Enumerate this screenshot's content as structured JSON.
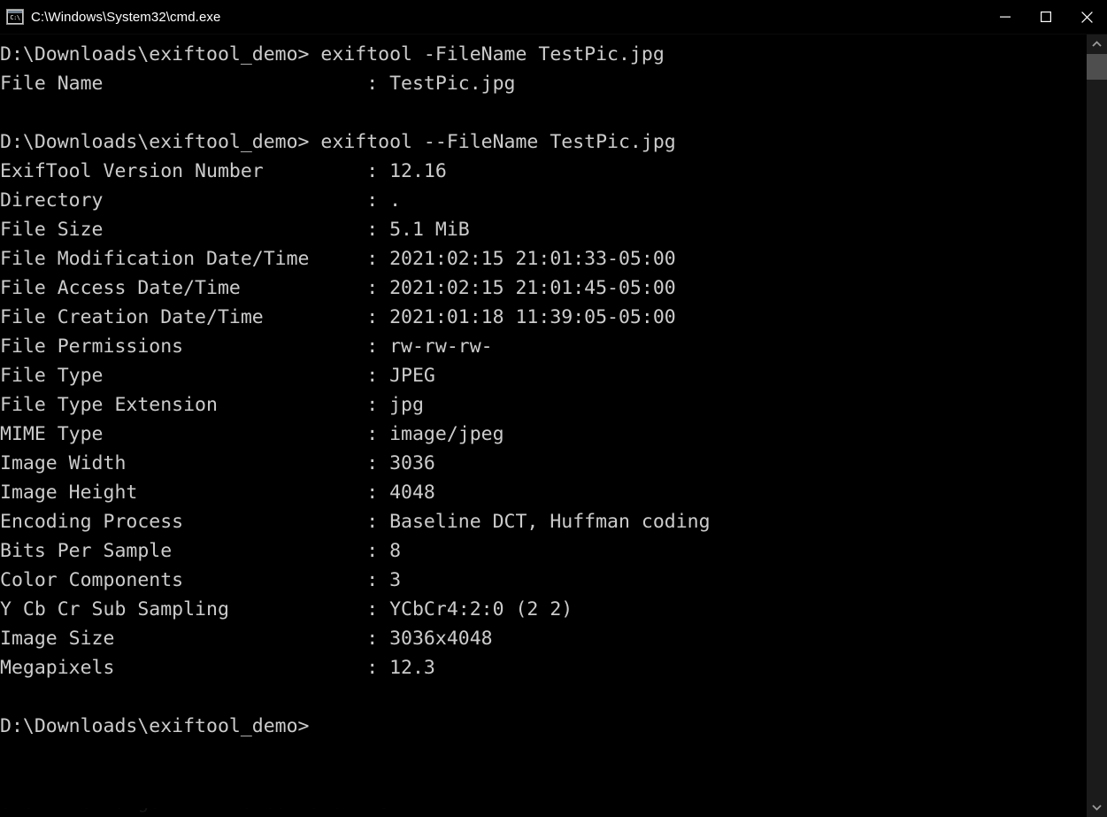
{
  "window": {
    "title": "C:\\Windows\\System32\\cmd.exe",
    "icon": "cmd-console-icon",
    "bg_color": "#000000",
    "text_color": "#cccccc",
    "controls": {
      "minimize": "minimize-button",
      "maximize": "maximize-button",
      "close": "close-button"
    }
  },
  "scrollbar": {
    "up_arrow": "scroll-up-arrow",
    "down_arrow": "scroll-down-arrow",
    "thumb_color": "#4e4e4e",
    "track_color": "#1b1b1b"
  },
  "terminal": {
    "prompt": "D:\\Downloads\\exiftool_demo>",
    "label_width": 32,
    "lines": [
      {
        "type": "command",
        "prompt": "D:\\Downloads\\exiftool_demo>",
        "command": " exiftool -FileName TestPic.jpg"
      },
      {
        "type": "pair",
        "label": "File Name",
        "value": "TestPic.jpg"
      },
      {
        "type": "blank",
        "text": ""
      },
      {
        "type": "command",
        "prompt": "D:\\Downloads\\exiftool_demo>",
        "command": " exiftool --FileName TestPic.jpg"
      },
      {
        "type": "pair",
        "label": "ExifTool Version Number",
        "value": "12.16"
      },
      {
        "type": "pair",
        "label": "Directory",
        "value": "."
      },
      {
        "type": "pair",
        "label": "File Size",
        "value": "5.1 MiB"
      },
      {
        "type": "pair",
        "label": "File Modification Date/Time",
        "value": "2021:02:15 21:01:33-05:00"
      },
      {
        "type": "pair",
        "label": "File Access Date/Time",
        "value": "2021:02:15 21:01:45-05:00"
      },
      {
        "type": "pair",
        "label": "File Creation Date/Time",
        "value": "2021:01:18 11:39:05-05:00"
      },
      {
        "type": "pair",
        "label": "File Permissions",
        "value": "rw-rw-rw-"
      },
      {
        "type": "pair",
        "label": "File Type",
        "value": "JPEG"
      },
      {
        "type": "pair",
        "label": "File Type Extension",
        "value": "jpg"
      },
      {
        "type": "pair",
        "label": "MIME Type",
        "value": "image/jpeg"
      },
      {
        "type": "pair",
        "label": "Image Width",
        "value": "3036"
      },
      {
        "type": "pair",
        "label": "Image Height",
        "value": "4048"
      },
      {
        "type": "pair",
        "label": "Encoding Process",
        "value": "Baseline DCT, Huffman coding"
      },
      {
        "type": "pair",
        "label": "Bits Per Sample",
        "value": "8"
      },
      {
        "type": "pair",
        "label": "Color Components",
        "value": "3"
      },
      {
        "type": "pair",
        "label": "Y Cb Cr Sub Sampling",
        "value": "YCbCr4:2:0 (2 2)"
      },
      {
        "type": "pair",
        "label": "Image Size",
        "value": "3036x4048"
      },
      {
        "type": "pair",
        "label": "Megapixels",
        "value": "12.3"
      },
      {
        "type": "blank",
        "text": ""
      },
      {
        "type": "command",
        "prompt": "D:\\Downloads\\exiftool_demo>",
        "command": ""
      }
    ],
    "ghost_line": "Show the target in the commandline"
  }
}
